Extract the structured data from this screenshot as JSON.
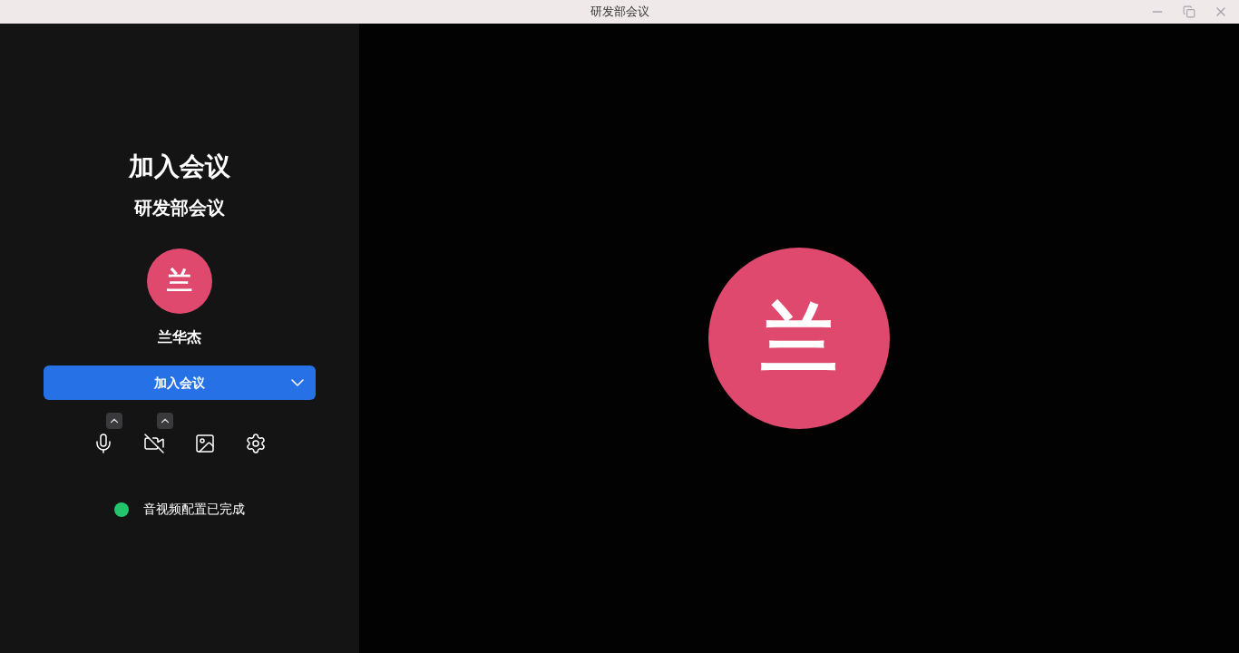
{
  "window": {
    "title": "研发部会议"
  },
  "join_panel": {
    "heading": "加入会议",
    "meeting_name": "研发部会议",
    "avatar_initial": "兰",
    "user_name": "兰华杰",
    "join_button": "加入会议",
    "controls": [
      {
        "kind": "microphone",
        "on": true
      },
      {
        "kind": "camera",
        "on": false
      },
      {
        "kind": "background"
      },
      {
        "kind": "settings"
      }
    ],
    "status": {
      "text": "音视频配置已完成",
      "color": "#22c56b"
    }
  },
  "preview": {
    "avatar_initial": "兰"
  }
}
